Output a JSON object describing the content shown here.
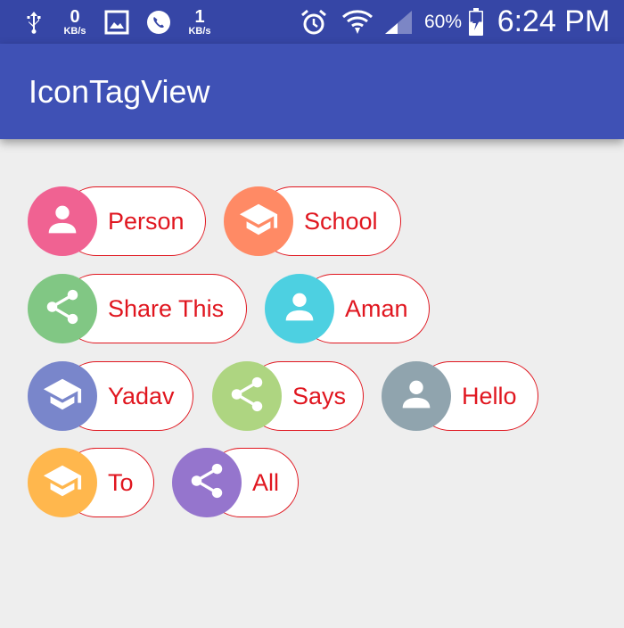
{
  "status_bar": {
    "net_speed_1": {
      "value": "0",
      "unit": "KB/s"
    },
    "net_speed_2": {
      "value": "1",
      "unit": "KB/s"
    },
    "battery_percent": "60%",
    "time": "6:24 PM",
    "icons": [
      "usb-icon",
      "image-icon",
      "viber-icon",
      "alarm-icon",
      "wifi-icon",
      "cell-signal-icon",
      "battery-charging-icon"
    ]
  },
  "app_bar": {
    "title": "IconTagView"
  },
  "tags": [
    {
      "label": "Person",
      "icon": "person-icon",
      "color": "#f06292"
    },
    {
      "label": "School",
      "icon": "school-icon",
      "color": "#ff8a65"
    },
    {
      "label": "Share This",
      "icon": "share-icon",
      "color": "#81c784"
    },
    {
      "label": "Aman",
      "icon": "person-icon",
      "color": "#4dd0e1"
    },
    {
      "label": "Yadav",
      "icon": "school-icon",
      "color": "#7986cb"
    },
    {
      "label": "Says",
      "icon": "share-icon",
      "color": "#aed581"
    },
    {
      "label": "Hello",
      "icon": "person-icon",
      "color": "#90a4ae"
    },
    {
      "label": "To",
      "icon": "school-icon",
      "color": "#ffb74d"
    },
    {
      "label": "All",
      "icon": "share-icon",
      "color": "#9575cd"
    }
  ],
  "colors": {
    "tag_text": "#e0161f",
    "tag_border": "#e0161f",
    "app_bar": "#3f51b5",
    "status_bar": "#3646a6",
    "background": "#eeeeee"
  }
}
